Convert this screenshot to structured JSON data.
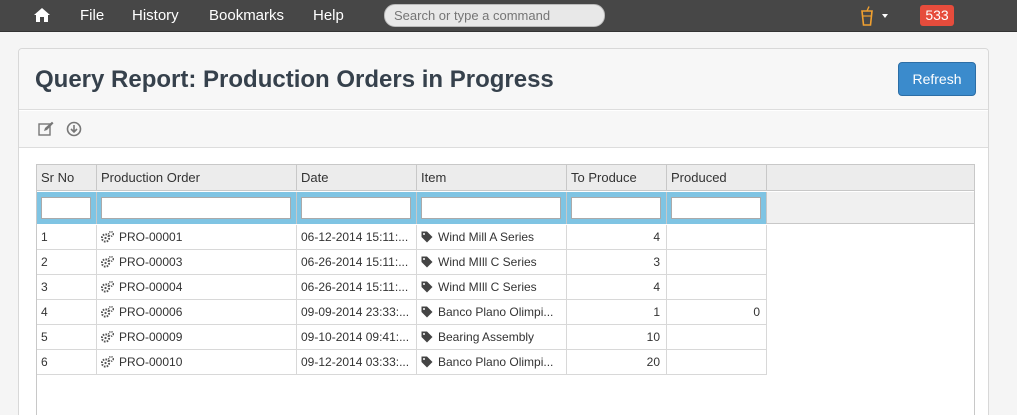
{
  "navbar": {
    "menu": [
      "File",
      "History",
      "Bookmarks",
      "Help"
    ],
    "search_placeholder": "Search or type a command",
    "notification_count": "533",
    "home_icon": "home-icon",
    "cup_icon": "drink-cup-icon"
  },
  "page": {
    "title": "Query Report: Production Orders in Progress",
    "refresh_label": "Refresh"
  },
  "table": {
    "columns": [
      "Sr No",
      "Production Order",
      "Date",
      "Item",
      "To Produce",
      "Produced"
    ],
    "rows": [
      {
        "sr": "1",
        "order": "PRO-00001",
        "date": "06-12-2014 15:11:...",
        "item": "Wind Mill A Series",
        "to_produce": "4",
        "produced": ""
      },
      {
        "sr": "2",
        "order": "PRO-00003",
        "date": "06-26-2014 15:11:...",
        "item": "Wind MIll C Series",
        "to_produce": "3",
        "produced": ""
      },
      {
        "sr": "3",
        "order": "PRO-00004",
        "date": "06-26-2014 15:11:...",
        "item": "Wind MIll C Series",
        "to_produce": "4",
        "produced": ""
      },
      {
        "sr": "4",
        "order": "PRO-00006",
        "date": "09-09-2014 23:33:...",
        "item": "Banco Plano Olimpi...",
        "to_produce": "1",
        "produced": "0"
      },
      {
        "sr": "5",
        "order": "PRO-00009",
        "date": "09-10-2014 09:41:...",
        "item": "Bearing Assembly",
        "to_produce": "10",
        "produced": ""
      },
      {
        "sr": "6",
        "order": "PRO-00010",
        "date": "09-12-2014 03:33:...",
        "item": "Banco Plano Olimpi...",
        "to_produce": "20",
        "produced": ""
      }
    ]
  },
  "colors": {
    "navbar": "#474747",
    "primary_button": "#3b8bcc",
    "badge": "#e64c3c",
    "filter_row": "#7fc4e3"
  }
}
